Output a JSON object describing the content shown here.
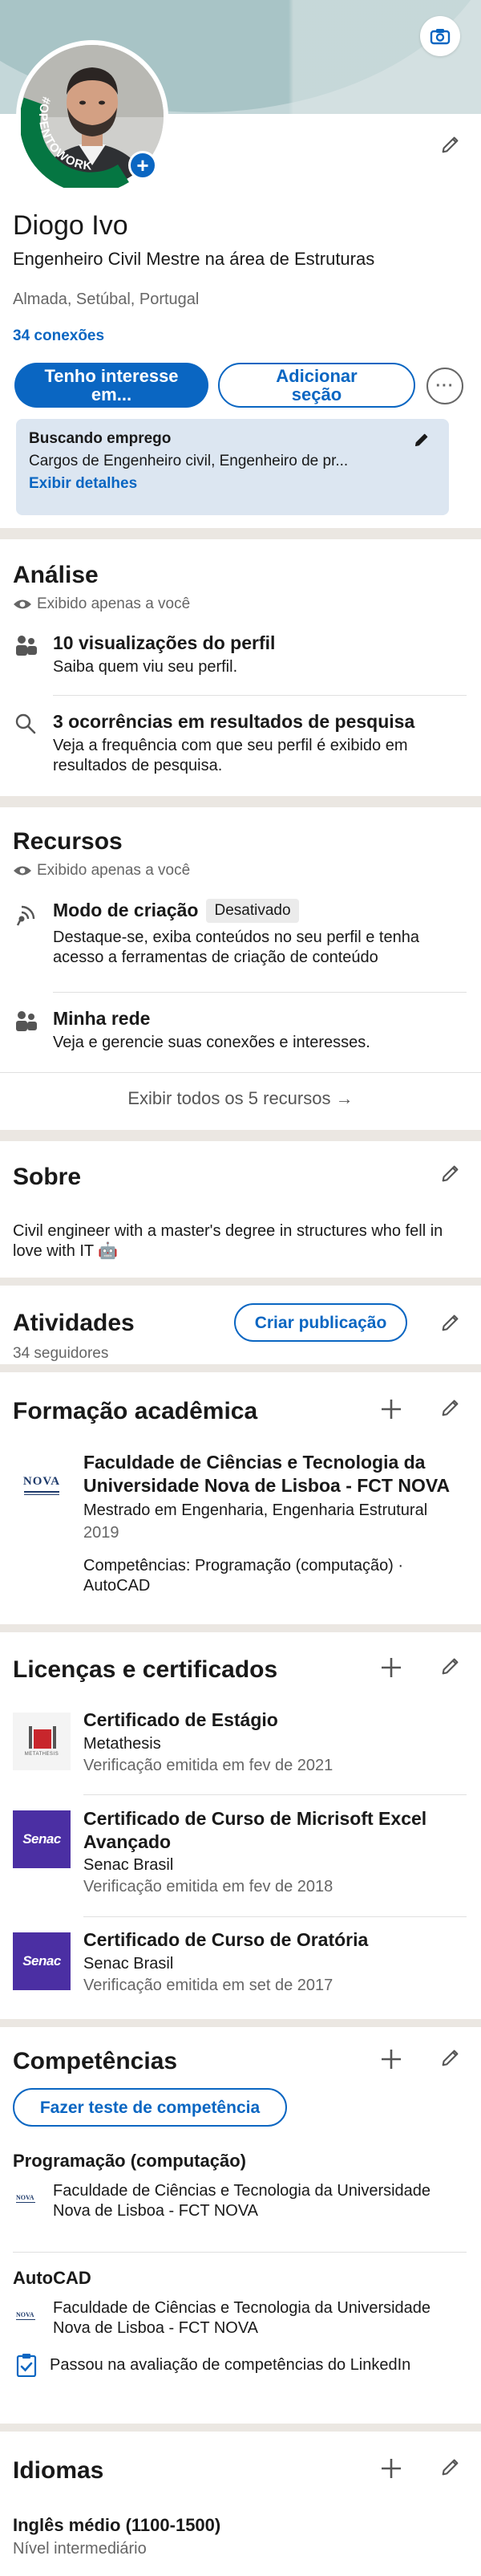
{
  "header": {
    "open_to_work": "#OPENTOWORK",
    "name": "Diogo Ivo",
    "headline": "Engenheiro Civil Mestre na área de Estruturas",
    "location": "Almada, Setúbal, Portugal",
    "connections": "34 conexões",
    "primary_button": "Tenho interesse em...",
    "secondary_button": "Adicionar seção",
    "more_button": "···",
    "job_seeking": {
      "title": "Buscando emprego",
      "roles": "Cargos de Engenheiro civil, Engenheiro de pr...",
      "details_link": "Exibir detalhes"
    }
  },
  "analytics": {
    "title": "Análise",
    "private_note": "Exibido apenas a você",
    "items": [
      {
        "title": "10 visualizações do perfil",
        "desc": "Saiba quem viu seu perfil.",
        "icon": "people-icon"
      },
      {
        "title": "3 ocorrências em resultados de pesquisa",
        "desc": "Veja a frequência com que seu perfil é exibido em resultados de pesquisa.",
        "icon": "search-icon"
      }
    ]
  },
  "resources": {
    "title": "Recursos",
    "private_note": "Exibido apenas a você",
    "items": [
      {
        "title": "Modo de criação",
        "badge": "Desativado",
        "desc": "Destaque-se, exiba conteúdos no seu perfil e tenha acesso a ferramentas de criação de conteúdo",
        "icon": "broadcast-icon"
      },
      {
        "title": "Minha rede",
        "desc": "Veja e gerencie suas conexões e interesses.",
        "icon": "people-icon"
      }
    ],
    "show_all": "Exibir todos os 5 recursos →"
  },
  "about": {
    "title": "Sobre",
    "text": "Civil engineer with a master's degree in structures who fell in love with IT 🤖"
  },
  "activity": {
    "title": "Atividades",
    "followers": "34 seguidores",
    "create_post": "Criar publicação"
  },
  "education": {
    "title": "Formação acadêmica",
    "items": [
      {
        "school": "Faculdade de Ciências e Tecnologia da Universidade Nova de Lisboa - FCT NOVA",
        "degree": "Mestrado em Engenharia, Engenharia Estrutural",
        "year": "2019",
        "skills": "Competências: Programação (computação) · AutoCAD",
        "logo": "NOVA"
      }
    ]
  },
  "licenses": {
    "title": "Licenças e certificados",
    "items": [
      {
        "name": "Certificado de Estágio",
        "issuer": "Metathesis",
        "date": "Verificação emitida em fev de 2021",
        "logo": "METATHESIS"
      },
      {
        "name": "Certificado de Curso de Micrisoft Excel Avançado",
        "issuer": "Senac Brasil",
        "date": "Verificação emitida em fev de 2018",
        "logo": "Senac"
      },
      {
        "name": "Certificado de Curso de Oratória",
        "issuer": "Senac Brasil",
        "date": "Verificação emitida em set de 2017",
        "logo": "Senac"
      }
    ]
  },
  "skills": {
    "title": "Competências",
    "test_button": "Fazer teste de competência",
    "items": [
      {
        "name": "Programação (computação)",
        "source": "Faculdade de Ciências e Tecnologia da Universidade Nova de Lisboa - FCT NOVA"
      },
      {
        "name": "AutoCAD",
        "source": "Faculdade de Ciências e Tecnologia da Universidade Nova de Lisboa - FCT NOVA",
        "assessment": "Passou na avaliação de competências do LinkedIn"
      }
    ]
  },
  "languages": {
    "title": "Idiomas",
    "items": [
      {
        "name": "Inglês médio (1100-1500)",
        "level": "Nível intermediário"
      }
    ]
  },
  "colors": {
    "accent": "#0a66c2",
    "open_to_work": "#057642",
    "separator": "#ebe7e2",
    "job_box": "#dce6f1",
    "senac": "#4b2fa3"
  }
}
